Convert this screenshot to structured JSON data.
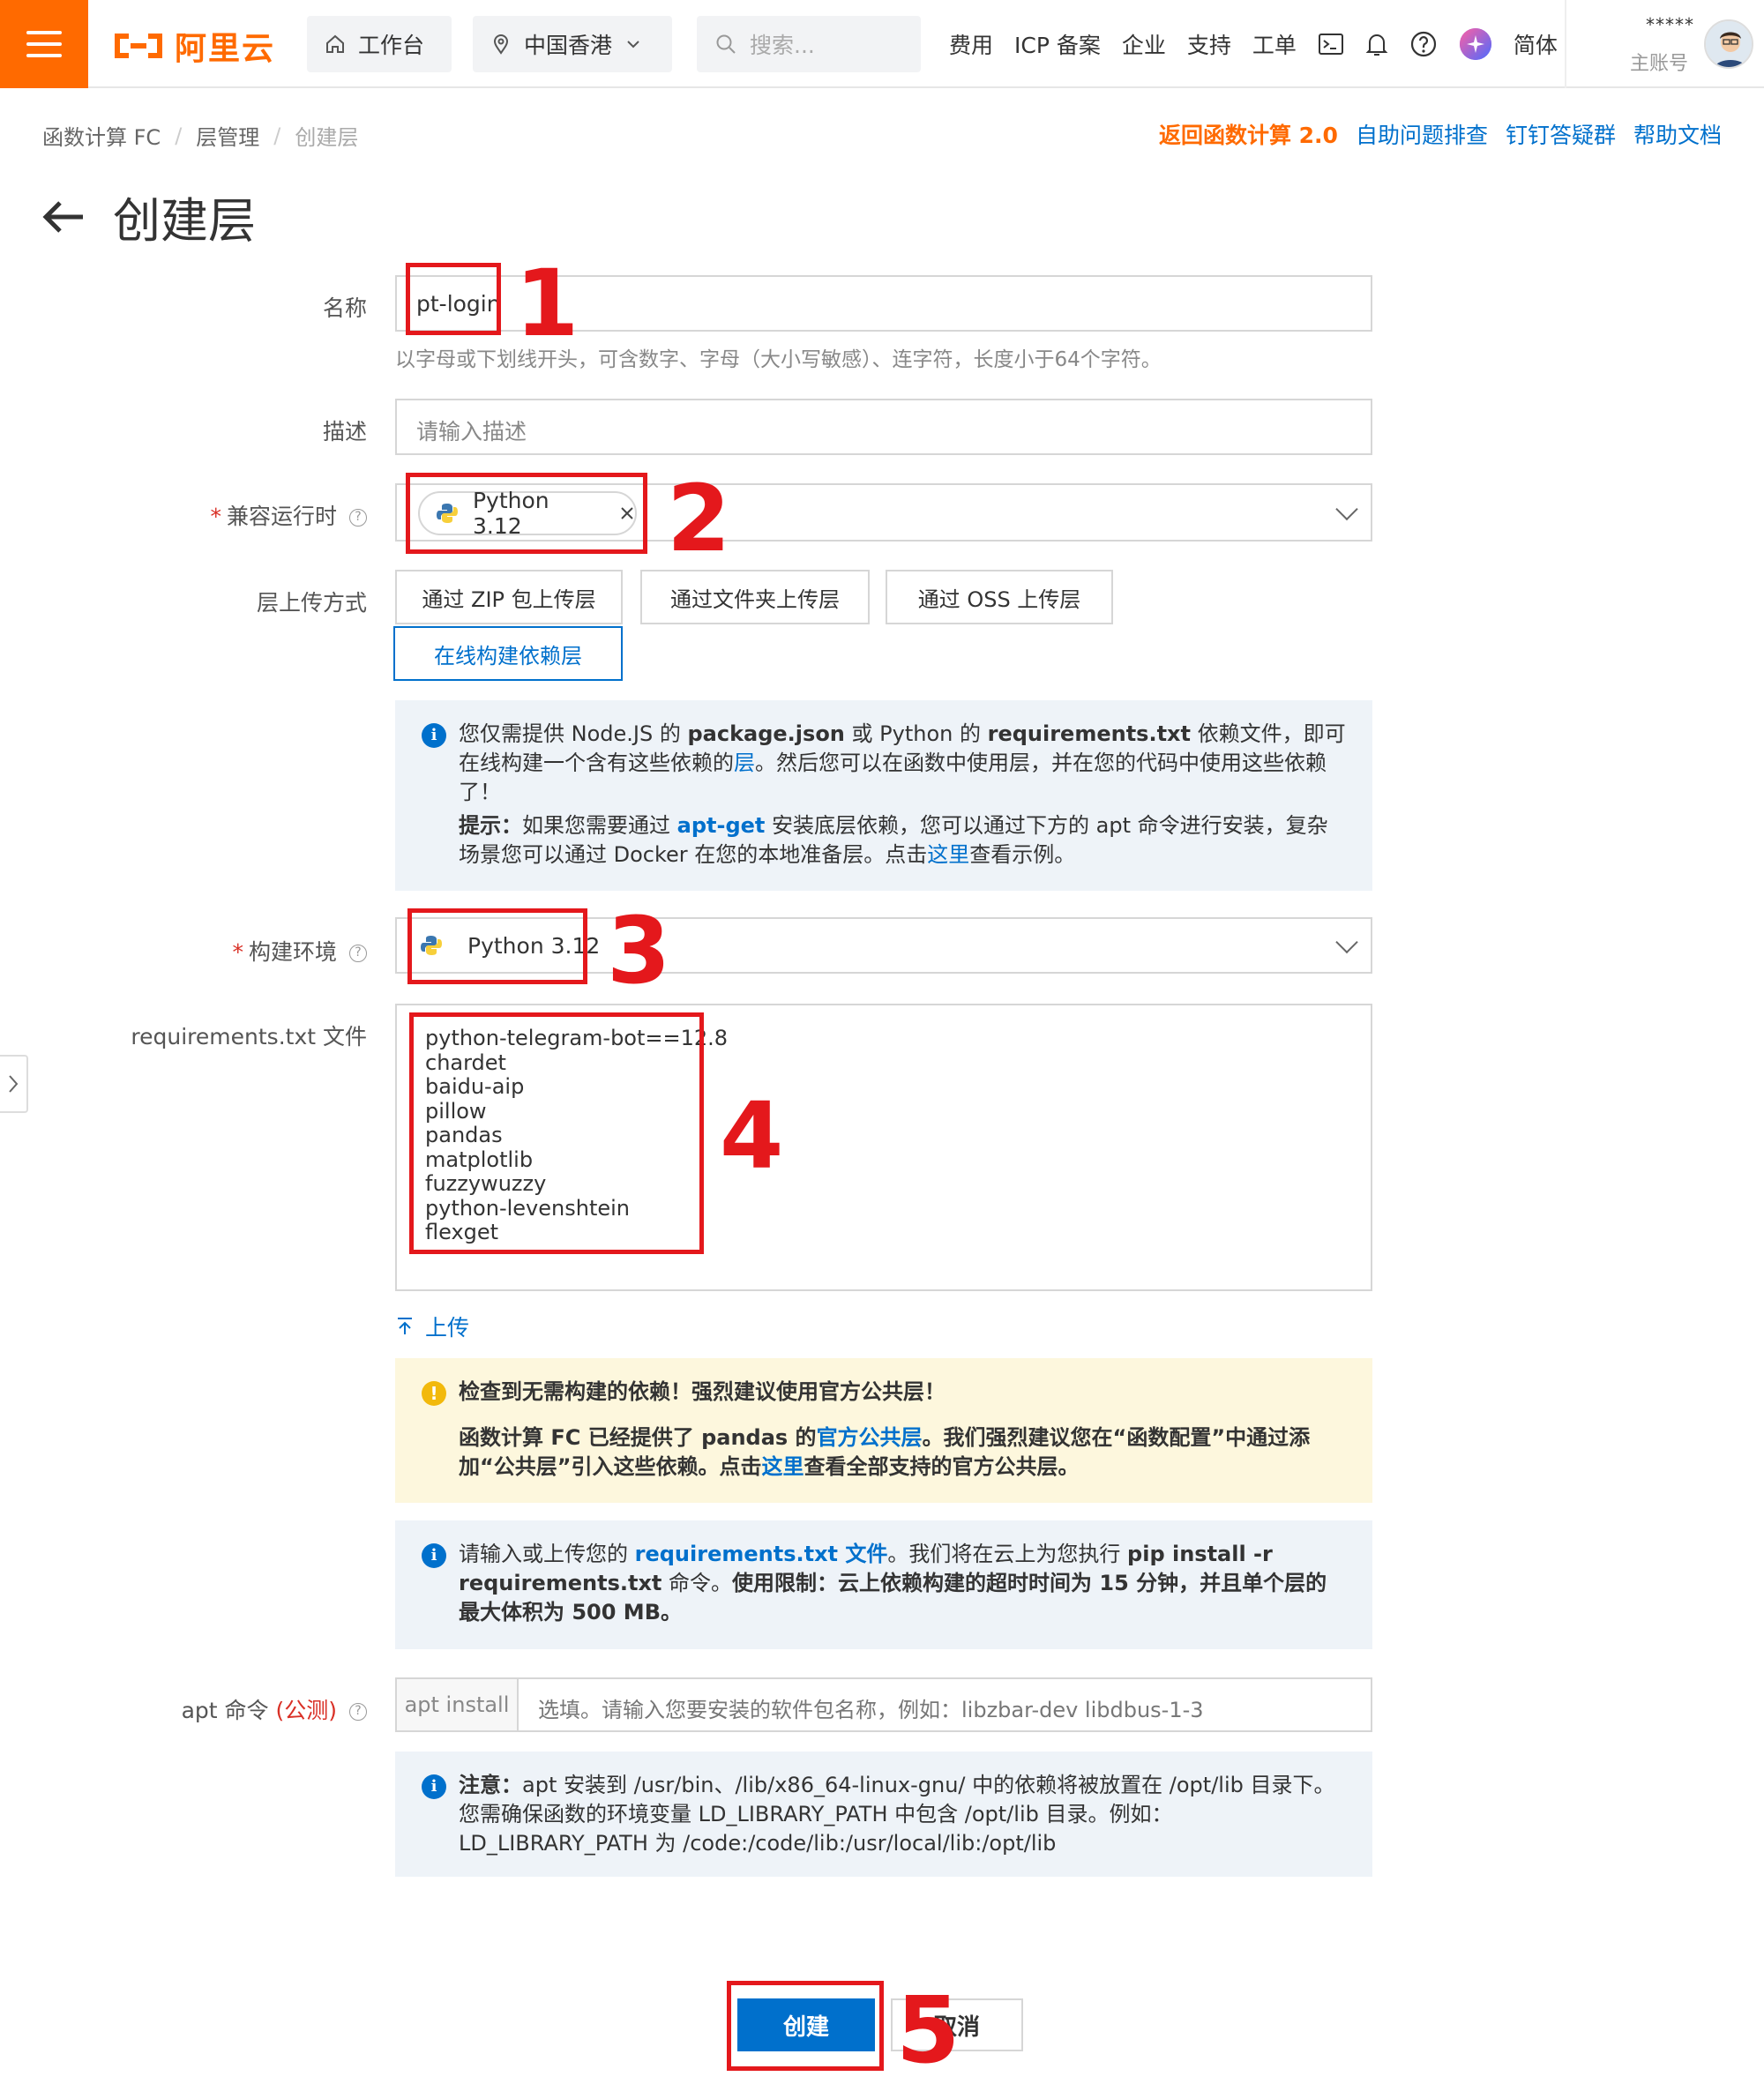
{
  "topbar": {
    "brand": "阿里云",
    "workbench": "工作台",
    "region": "中国香港",
    "search_placeholder": "搜索...",
    "nav": [
      "费用",
      "ICP 备案",
      "企业",
      "支持",
      "工单"
    ],
    "language": "简体",
    "account_name": "*****",
    "account_type": "主账号"
  },
  "breadcrumb": [
    "函数计算 FC",
    "层管理",
    "创建层"
  ],
  "help_links": [
    "返回函数计算 2.0",
    "自助问题排查",
    "钉钉答疑群",
    "帮助文档"
  ],
  "page_title": "创建层",
  "form": {
    "name_label": "名称",
    "name_value": "pt-login",
    "name_hint": "以字母或下划线开头，可含数字、字母（大小写敏感）、连字符，长度小于64个字符。",
    "desc_label": "描述",
    "desc_placeholder": "请输入描述",
    "runtime_label": "兼容运行时",
    "runtime_tag": "Python 3.12",
    "upload_method_label": "层上传方式",
    "upload_methods": [
      "通过 ZIP 包上传层",
      "通过文件夹上传层",
      "通过 OSS 上传层",
      "在线构建依赖层"
    ],
    "info1": {
      "p1_a": "您仅需提供 Node.JS 的 ",
      "p1_b": "package.json",
      "p1_c": " 或 Python 的 ",
      "p1_d": "requirements.txt",
      "p1_e": " 依赖文件，即可在线构建一个含有这些依赖的",
      "p1_link": "层",
      "p1_f": "。然后您可以在函数中使用层，并在您的代码中使用这些依赖了！",
      "p2_a": "提示：",
      "p2_b": "如果您需要通过 ",
      "p2_link": "apt-get",
      "p2_c": " 安装底层依赖，您可以通过下方的 apt 命令进行安装，复杂场景您可以通过 Docker 在您的本地准备层。点击",
      "p2_link2": "这里",
      "p2_d": "查看示例。"
    },
    "build_env_label": "构建环境",
    "build_env_value": "Python 3.12",
    "requirements_label": "requirements.txt 文件",
    "requirements_text": "python-telegram-bot==12.8\nchardet\nbaidu-aip\npillow\npandas\nmatplotlib\nfuzzywuzzy\npython-levenshtein\nflexget",
    "upload_link": "上传",
    "warning": {
      "title": "检查到无需构建的依赖！强烈建议使用官方公共层！",
      "b_a": "函数计算 FC 已经提供了 pandas 的",
      "b_link": "官方公共层",
      "b_b": "。我们强烈建议您在“函数配置”中通过添加“公共层”引入这些依赖。点击",
      "b_link2": "这里",
      "b_c": "查看全部支持的官方公共层。"
    },
    "info2": {
      "a": "请输入或上传您的 ",
      "link": "requirements.txt 文件",
      "b": "。我们将在云上为您执行 ",
      "c": "pip install -r requirements.txt",
      "d": " 命令。",
      "e": "使用限制：云上依赖构建的超时时间为 15 分钟，并且单个层的最大体积为 500 MB。"
    },
    "apt_label": "apt 命令",
    "apt_beta": "(公测)",
    "apt_prefix": "apt install",
    "apt_placeholder": "选填。请输入您要安装的软件包名称，例如：libzbar-dev libdbus-1-3",
    "info3": {
      "a": "注意：",
      "b": "apt 安装到 /usr/bin、/lib/x86_64-linux-gnu/ 中的依赖将被放置在 /opt/lib 目录下。您需确保函数的环境变量 LD_LIBRARY_PATH 中包含 /opt/lib 目录。例如：LD_LIBRARY_PATH 为 /code:/code/lib:/usr/local/lib:/opt/lib"
    },
    "create_button": "创建",
    "cancel_button": "取消"
  },
  "annotations": [
    "1",
    "2",
    "3",
    "4",
    "5"
  ],
  "colors": {
    "brand": "#ff6a00",
    "primary": "#0070cc",
    "annotation": "#e4181c"
  }
}
